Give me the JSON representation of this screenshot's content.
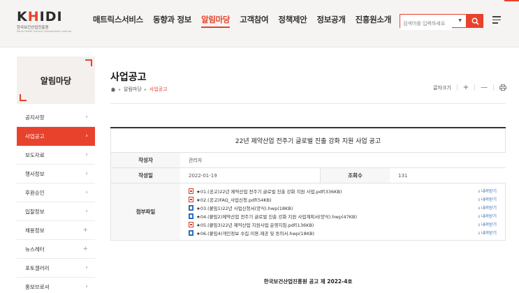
{
  "header": {
    "logo_text_1": "K",
    "logo_text_accent": "H",
    "logo_text_2": "IDI",
    "logo_sub": "한국보건산업진흥원",
    "logo_sub_en": "Korea Health Industry Development Institute",
    "nav": [
      {
        "label": "매트릭스서비스"
      },
      {
        "label": "동향과 정보"
      },
      {
        "label": "알림마당"
      },
      {
        "label": "고객참여"
      },
      {
        "label": "정책제안"
      },
      {
        "label": "정보공개"
      },
      {
        "label": "진흥원소개"
      }
    ],
    "search_placeholder": "검색어를 입력하세요"
  },
  "sidebar": {
    "title": "알림마당",
    "items": [
      {
        "label": "공지사항",
        "arrow": "›"
      },
      {
        "label": "사업공고",
        "arrow": "›"
      },
      {
        "label": "보도자료",
        "arrow": "›"
      },
      {
        "label": "행사정보",
        "arrow": "›"
      },
      {
        "label": "후원승인",
        "arrow": "›"
      },
      {
        "label": "입찰정보",
        "arrow": "›"
      },
      {
        "label": "채용정보",
        "arrow": "+"
      },
      {
        "label": "뉴스레터",
        "arrow": "+"
      },
      {
        "label": "포토갤러리",
        "arrow": "›"
      },
      {
        "label": "홍보브로셔",
        "arrow": "›"
      }
    ]
  },
  "content": {
    "page_title": "사업공고",
    "breadcrumb": [
      "알림마당",
      "사업공고"
    ],
    "font_size_label": "글자크기",
    "post": {
      "title": "22년 제약산업 전주기 글로벌 진출 강화 지원 사업 공고",
      "author_label": "작성자",
      "author": "관리자",
      "date_label": "작성일",
      "date": "2022-01-19",
      "views_label": "조회수",
      "views": "131",
      "files_label": "첨부파일",
      "download_label": "내려받기",
      "files": [
        {
          "name": "★01.(공고)22년 제약산업 전주기 글로벌 진출 강화 지원 사업.pdf(336KB)",
          "type": "pdf"
        },
        {
          "name": "★02.(공고)FAQ_사업신청.pdf(54KB)",
          "type": "pdf"
        },
        {
          "name": "★03.(붙임1)22년 사업신청서(양식).hwp(18KB)",
          "type": "hwp"
        },
        {
          "name": "★04.(붙임2)제약산업 전주기 글로벌 진출 강화 지원 사업계획서(양식).hwp(47KB)",
          "type": "hwp"
        },
        {
          "name": "★05.(붙임3)22년 제약산업 지원사업 운영지침.pdf(136KB)",
          "type": "pdf"
        },
        {
          "name": "★06.(붙임4)개인정보 수집.이용.제공 및 동의서.hwp(18KB)",
          "type": "hwp"
        }
      ],
      "footer_note": "한국보건산업진흥원 공고 제 2022-4호"
    }
  }
}
